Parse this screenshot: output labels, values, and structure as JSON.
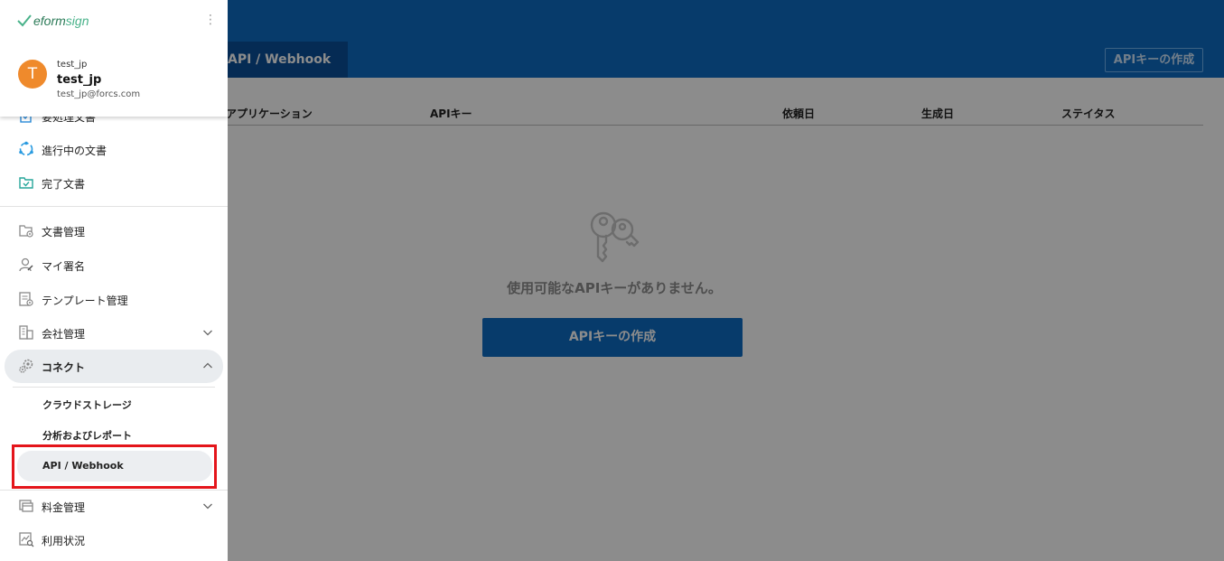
{
  "header": {
    "active_tab_label": "API / Webhook",
    "create_button_label": "APIキーの作成"
  },
  "table": {
    "columns": [
      "アプリケーション",
      "APIキー",
      "依頼日",
      "生成日",
      "ステイタス"
    ]
  },
  "empty_state": {
    "icon": "key-icon",
    "message": "使用可能なAPIキーがありません。",
    "button_label": "APIキーの作成"
  },
  "sidebar": {
    "logo_text_a": "eform",
    "logo_text_b": "sign",
    "profile": {
      "avatar_letter": "T",
      "company": "test_jp",
      "username": "test_jp",
      "email": "test_jp@forcs.com"
    },
    "items": [
      {
        "label": "要処理文書",
        "icon": "document-todo-icon"
      },
      {
        "label": "進行中の文書",
        "icon": "progress-icon"
      },
      {
        "label": "完了文書",
        "icon": "completed-doc-icon"
      },
      {
        "label": "文書管理",
        "icon": "folder-gear-icon"
      },
      {
        "label": "マイ署名",
        "icon": "person-sign-icon"
      },
      {
        "label": "テンプレート管理",
        "icon": "template-gear-icon"
      },
      {
        "label": "会社管理",
        "icon": "building-icon"
      },
      {
        "label": "コネクト",
        "icon": "gears-icon"
      },
      {
        "label": "料金管理",
        "icon": "billing-icon"
      },
      {
        "label": "利用状況",
        "icon": "usage-icon"
      }
    ],
    "connect_sub_items": [
      "クラウドストレージ",
      "分析およびレポート",
      "API / Webhook"
    ]
  },
  "colors": {
    "primary": "#0d6cc4",
    "highlight": "#e4151b",
    "avatar": "#ef8a2c"
  }
}
